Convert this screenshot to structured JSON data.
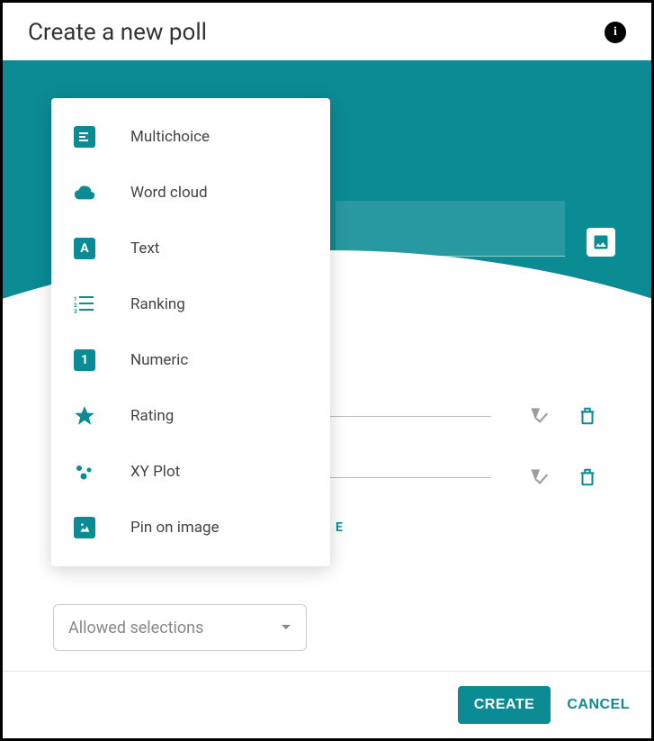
{
  "header": {
    "title": "Create a new poll"
  },
  "dropdown": {
    "items": [
      {
        "label": "Multichoice",
        "icon": "multichoice-icon"
      },
      {
        "label": "Word cloud",
        "icon": "cloud-icon"
      },
      {
        "label": "Text",
        "icon": "text-icon"
      },
      {
        "label": "Ranking",
        "icon": "ranking-icon"
      },
      {
        "label": "Numeric",
        "icon": "numeric-icon"
      },
      {
        "label": "Rating",
        "icon": "rating-icon"
      },
      {
        "label": "XY Plot",
        "icon": "scatter-icon"
      },
      {
        "label": "Pin on image",
        "icon": "image-pin-icon"
      }
    ]
  },
  "link_tail": "E",
  "allowed_select": {
    "placeholder": "Allowed selections"
  },
  "footer": {
    "create": "CREATE",
    "cancel": "CANCEL"
  }
}
